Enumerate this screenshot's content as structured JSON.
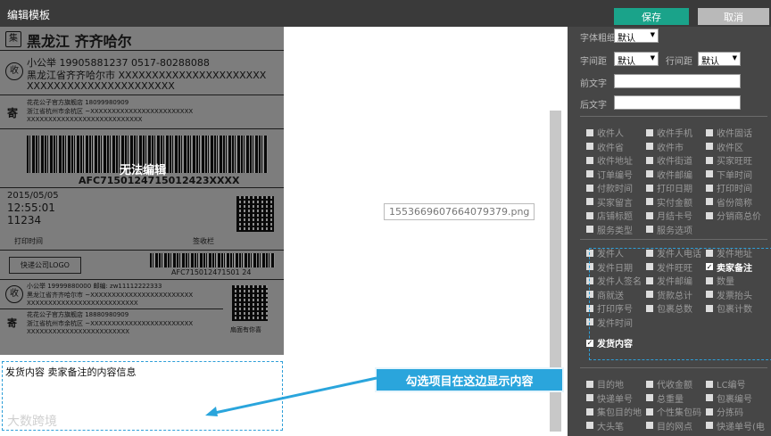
{
  "window": {
    "title": "编辑模板"
  },
  "toolbar": {
    "save_label": "保存",
    "cancel_label": "取消"
  },
  "label": {
    "province_city": "黑龙江 齐齐哈尔",
    "icon_ji": "集",
    "icon_shou": "收",
    "icon_ji2": "寄",
    "recipient_line": "小公举   19905881237   0517-80288088",
    "recipient_addr1": "黑龙江省齐齐哈尔市 XXXXXXXXXXXXXXXXXXXXXX",
    "recipient_addr2": "XXXXXXXXXXXXXXXXXXXXXX",
    "sender_line": "花花公子官方旗舰店   18099980909",
    "sender_addr1": "浙江省杭州市余杭区 ~XXXXXXXXXXXXXXXXXXXXXXXX",
    "sender_addr2": "XXXXXXXXXXXXXXXXXXXXXXXXXXX",
    "tracking": "AFC7150124715012423XXXX",
    "date": "2015/05/05",
    "time": "12:55:01",
    "code": "11234",
    "print_time": "打印时间",
    "sign": "签收栏",
    "logo": "快递公司LOGO",
    "tracking2": "AFC715012471501 24",
    "r2_line": "小公举  19999880000  邮编: zw11112222333",
    "r2_addr1": "黑龙江省齐齐哈尔市 ~XXXXXXXXXXXXXXXXXXXXXXXX",
    "r2_addr2": "XXXXXXXXXXXXXXXXXXXXXXXXXX",
    "s2_line": "花花公子官方旗舰店   18880980909",
    "s2_addr1": "浙江省杭州市余杭区 ~XXXXXXXXXXXXXXXXXXXXXXXX",
    "s2_addr2": "XXXXXXXXXXXXXXXXXXXXXXXX",
    "qr_caption": "扇面有你喜",
    "no_edit": "无法编辑"
  },
  "content_area": {
    "text": "发货内容  卖家备注的内容信息"
  },
  "watermark": "大数跨境",
  "image_tooltip": "1553669607664079379.png",
  "panel": {
    "font_weight_label": "字体粗细",
    "font_weight_value": "默认",
    "char_spacing_label": "字间距",
    "char_spacing_value": "默认",
    "line_spacing_label": "行间距",
    "line_spacing_value": "默认",
    "prefix_label": "前文字",
    "suffix_label": "后文字",
    "group1": [
      [
        "收件人",
        "收件手机",
        "收件固话"
      ],
      [
        "收件省",
        "收件市",
        "收件区"
      ],
      [
        "收件地址",
        "收件街道",
        "买家旺旺"
      ],
      [
        "订单编号",
        "收件邮编",
        "下单时间"
      ],
      [
        "付款时间",
        "打印日期",
        "打印时间"
      ],
      [
        "买家留言",
        "实付金额",
        "省份简称"
      ],
      [
        "店铺标题",
        "月结卡号",
        "分销商总价"
      ],
      [
        "服务类型",
        "服务选项",
        ""
      ]
    ],
    "group2": [
      [
        "发件人",
        "发件人电话",
        "发件地址"
      ],
      [
        "发件日期",
        "发件旺旺",
        "卖家备注"
      ],
      [
        "发件人签名",
        "发件邮编",
        "数量"
      ],
      [
        "商就送",
        "货款总计",
        "发票抬头"
      ],
      [
        "打印序号",
        "包裹总数",
        "包裹计数"
      ],
      [
        "发件时间",
        "",
        ""
      ]
    ],
    "checked_item": "卖家备注",
    "content_checkbox": "发货内容",
    "group3": [
      [
        "目的地",
        "代收金额",
        "LC编号"
      ],
      [
        "快递单号",
        "总重量",
        "包裹编号"
      ],
      [
        "集包目的地",
        "个性集包码",
        "分拣码"
      ],
      [
        "大头笔",
        "目的网点",
        "快递单号(电"
      ]
    ]
  },
  "callout": "勾选项目在这边显示内容"
}
